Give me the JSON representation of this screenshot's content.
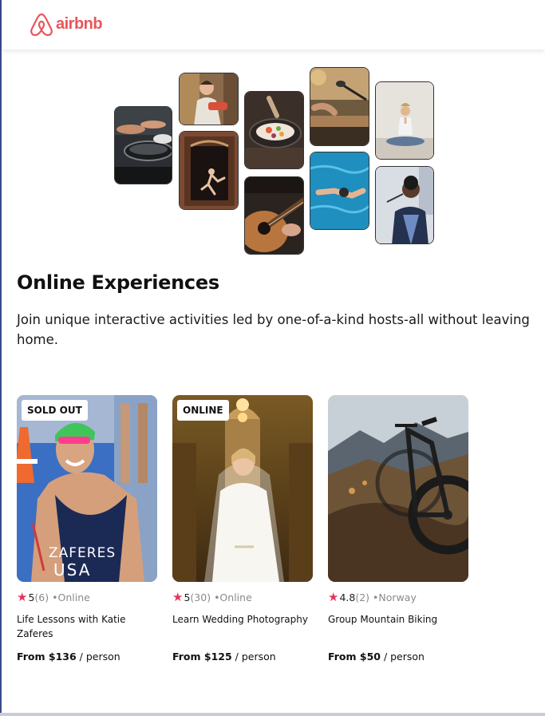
{
  "brand": {
    "name": "airbnb",
    "color": "#e9555c",
    "icon": "airbnb-logo-icon"
  },
  "hero": {
    "photos": [
      "cooking-photo",
      "chef-photo",
      "dancer-photo",
      "food-bowl-photo",
      "guitar-photo",
      "singer-mic-photo",
      "swimmer-photo",
      "yoga-photo",
      "performer-photo"
    ]
  },
  "section": {
    "title": "Online Experiences",
    "subtitle": "Join unique interactive activities led by one-of-a-kind hosts-all without leaving home."
  },
  "cards": [
    {
      "badge": "SOLD OUT",
      "rating": "5",
      "count": "(6)",
      "location": "•Online",
      "title": "Life Lessons with Katie Zaferes",
      "price": "From $136",
      "unit": " / person",
      "jersey": "ZAFERES USA"
    },
    {
      "badge": "ONLINE",
      "rating": "5",
      "count": "(30)",
      "location": "•Online",
      "title": "Learn Wedding Photography",
      "price": "From $125",
      "unit": " / person"
    },
    {
      "badge": "",
      "rating": "4.8",
      "count": "(2)",
      "location": "•Norway",
      "title": "Group Mountain Biking",
      "price": "From $50",
      "unit": " / person"
    }
  ],
  "colors": {
    "star": "#e9325a",
    "muted": "#8a8a8a",
    "accent": "#e9555c"
  }
}
